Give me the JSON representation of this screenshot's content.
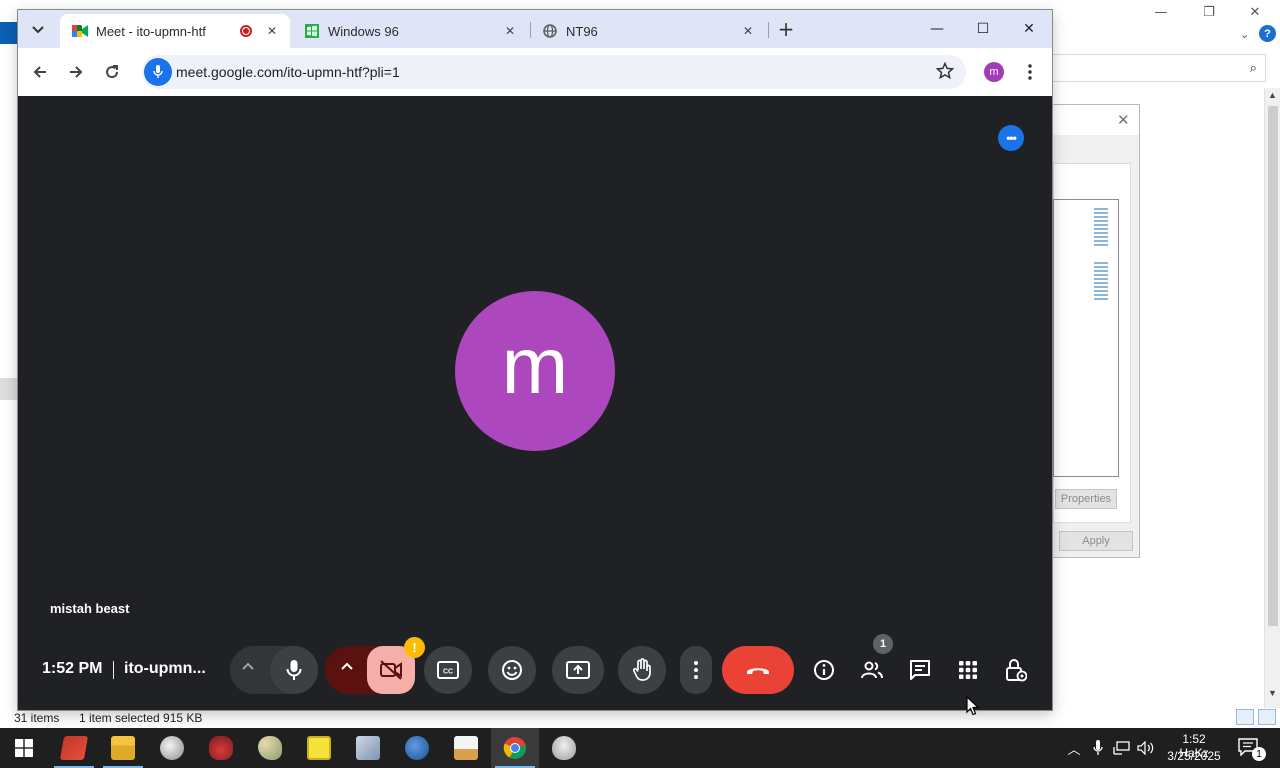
{
  "browser": {
    "tabs": [
      {
        "title": "Meet - ito-upmn-htf",
        "active": true
      },
      {
        "title": "Windows 96",
        "active": false
      },
      {
        "title": "NT96",
        "active": false
      }
    ],
    "url": "meet.google.com/ito-upmn-htf?pli=1",
    "profile_initial": "m",
    "colors": {
      "tabstrip": "#dfe5f6",
      "omnibox": "#eef1f8",
      "accent": "#1a73e8"
    }
  },
  "meet": {
    "participant_initial": "m",
    "participant_name": "mistah beast",
    "clock": "1:52 PM",
    "meeting_code": "ito-upmn...",
    "camera_warning": "!",
    "people_count": "1",
    "icons": [
      "more-options-icon",
      "expand-up-icon",
      "microphone-icon",
      "camera-off-icon",
      "captions-icon",
      "emoji-icon",
      "present-screen-icon",
      "raise-hand-icon",
      "more-vert-icon",
      "end-call-icon",
      "info-icon",
      "people-icon",
      "chat-icon",
      "activities-icon",
      "host-controls-icon"
    ],
    "colors": {
      "background": "#202124",
      "avatar": "#ac47be",
      "end_call": "#ea4335",
      "camera_off": "#f6aea9",
      "warning": "#fbbc04"
    }
  },
  "explorer": {
    "status_count": "31 items",
    "status_selection": "1 item selected  915 KB",
    "dialog_properties": "Properties",
    "dialog_apply": "Apply"
  },
  "taskbar": {
    "time": "1:52 HaKz",
    "date": "3/25/2025",
    "notification_count": "1",
    "apps": [
      "app-red-icon",
      "file-explorer-icon",
      "app-icon-3",
      "app-icon-4",
      "paint-icon",
      "spongebob-icon",
      "app-icon-7",
      "app-icon-8",
      "app-icon-9",
      "chrome-icon",
      "app-icon-11"
    ]
  }
}
